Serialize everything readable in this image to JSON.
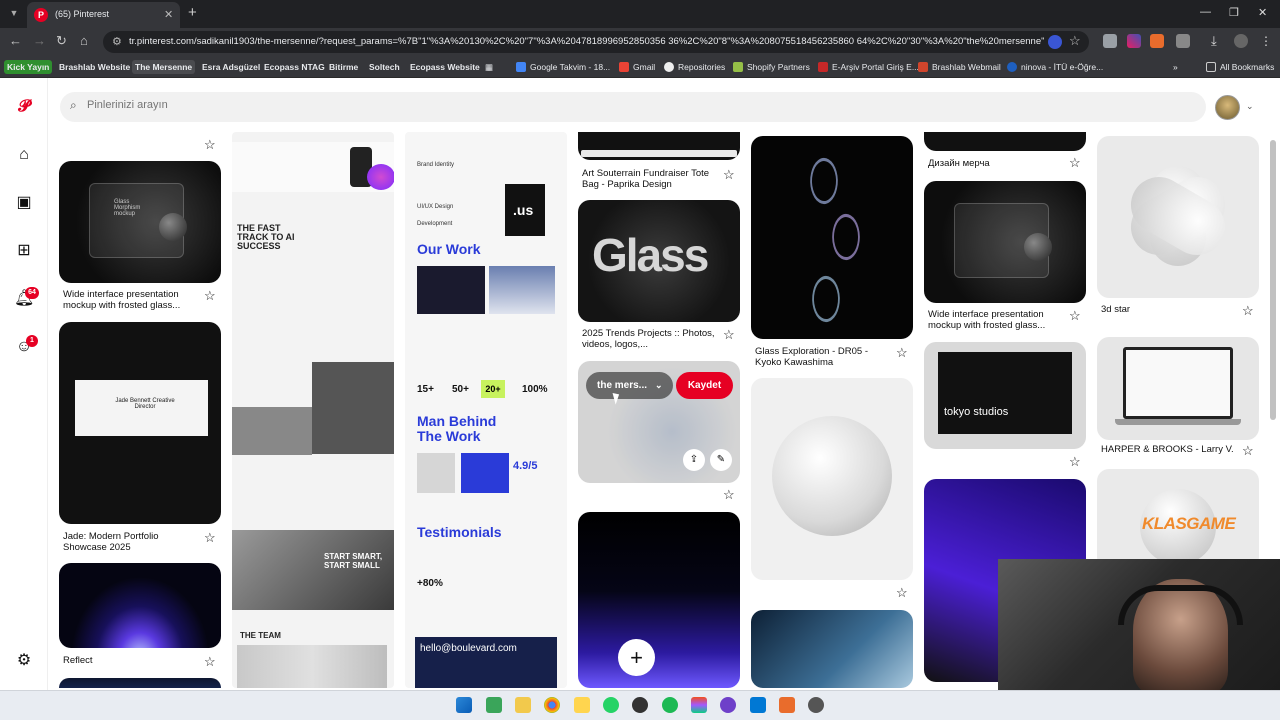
{
  "browser": {
    "tab_title": "(65) Pinterest",
    "url": "tr.pinterest.com/sadikanil1903/the-mersenne/?request_params=%7B\"1\"%3A%20130%2C%20\"7\"%3A%2047818996952850356 36%2C%20\"8\"%3A%208075518456235860 64%2C%20\"30\"%3A%20\"the%20mersenne\"%2C%2...",
    "bookmarks": [
      "Kick Yayın",
      "Brashlab Website",
      "The Mersenne",
      "Esra Adsgüzel",
      "Ecopass NTAG",
      "Bitirme",
      "Soltech",
      "Ecopass Website",
      "Google Takvim - 18...",
      "Gmail",
      "Repositories",
      "Shopify Partners",
      "E-Arşiv Portal Giriş E...",
      "Brashlab Webmail",
      "ninova - İTÜ e-Öğre...",
      "All Bookmarks"
    ],
    "accent": "#e60023"
  },
  "sidebar": {
    "notifications_badge": "64",
    "messages_badge": "1"
  },
  "search": {
    "placeholder": "Pinlerinizi arayın"
  },
  "pins": {
    "frosted_glass": "Wide interface presentation mockup with frosted glass...",
    "jade": "Jade: Modern Portfolio Showcase 2025",
    "reflect": "Reflect",
    "tote": "Art Souterrain Fundraiser Tote Bag - Paprika Design",
    "trends": "2025 Trends Projects :: Photos, videos, logos,...",
    "glass_exploration": "Glass Exploration - DR05 - Kyoko Kawashima",
    "merch": "Дизайн мерча",
    "frosted_glass_2": "Wide interface presentation mockup with frosted glass...",
    "star3d": "3d star",
    "harper": "HARPER & BROOKS - Larry V."
  },
  "hover_card": {
    "board": "the mers...",
    "save": "Kaydet"
  },
  "pin_texts": {
    "glass_word": "Glass",
    "tokyo": "tokyo studios",
    "our_work": "Our Work",
    "man_behind": "Man Behind The Work",
    "testimonials": "Testimonials",
    "hello": "hello@boulevard.com",
    "fast_track": "THE FAST TRACK TO AI SUCCESS",
    "start_smart": "START SMART, START SMALL",
    "the_team": "THE TEAM",
    "stat1": "15+",
    "stat2": "50+",
    "stat3": "20+",
    "stat4": "100%",
    "rating": "4.9/5",
    "pct": "+80%",
    "us": ".us",
    "jade_name": "Jade Bennett Creative Director",
    "brand_identity": "Brand Identity",
    "uiux": "UI/UX Design",
    "development": "Development",
    "mockup_title": "Glass Morphism mockup"
  },
  "overlay": {
    "watermark": "KLASGAME"
  }
}
